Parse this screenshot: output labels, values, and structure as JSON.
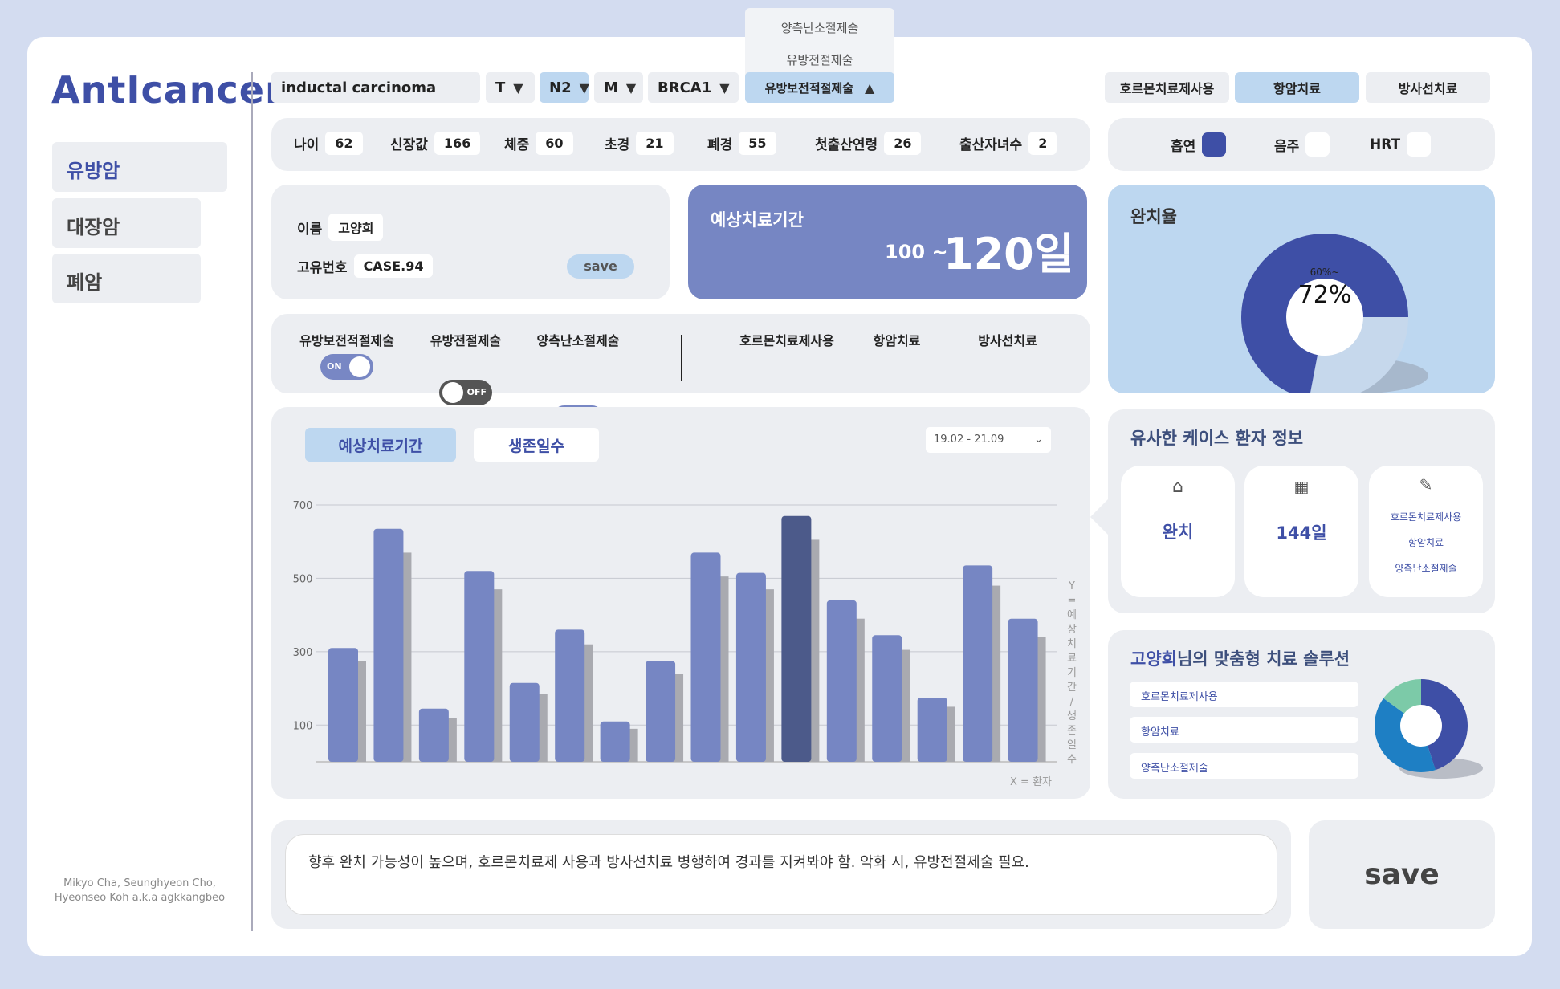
{
  "brand": {
    "logo": "AntIcancer"
  },
  "sidebar": {
    "items": [
      {
        "label": "유방암"
      },
      {
        "label": "대장암"
      },
      {
        "label": "폐암"
      }
    ],
    "credit_line1": "Mikyo Cha, Seunghyeon Cho,",
    "credit_line2": "Hyeonseo Koh a.k.a agkkangbeo"
  },
  "top": {
    "diagnosis": "inductal carcinoma",
    "t": "T",
    "n": "N2",
    "m": "M",
    "gene": "BRCA1",
    "surgery_options": [
      "양측난소절제술",
      "유방전절제술"
    ],
    "surgery_selected": "유방보전적절제술",
    "treatments": [
      "호르몬치료제사용",
      "항암치료",
      "방사선치료"
    ]
  },
  "stats": [
    {
      "label": "나이",
      "value": "62"
    },
    {
      "label": "신장값",
      "value": "166"
    },
    {
      "label": "체중",
      "value": "60"
    },
    {
      "label": "초경",
      "value": "21"
    },
    {
      "label": "폐경",
      "value": "55"
    },
    {
      "label": "첫출산연령",
      "value": "26"
    },
    {
      "label": "출산자녀수",
      "value": "2"
    }
  ],
  "habits": [
    {
      "label": "흡연",
      "checked": true
    },
    {
      "label": "음주",
      "checked": false
    },
    {
      "label": "HRT",
      "checked": false
    }
  ],
  "patient": {
    "name_label": "이름",
    "name": "고양희",
    "id_label": "고유번호",
    "id": "CASE.94",
    "save": "save"
  },
  "estimate": {
    "title": "예상치료기간",
    "range_from": "100 ~",
    "range_to": "120일"
  },
  "cure": {
    "title": "완치율",
    "sub": "60%~",
    "value": "72%",
    "fraction": 0.72
  },
  "toggles": [
    {
      "label": "유방보전적절제술",
      "state": "ON"
    },
    {
      "label": "유방전절제술",
      "state": "OFF"
    },
    {
      "label": "양측난소절제술",
      "state": "ON"
    },
    {
      "label": "호르몬치료제사용",
      "state": "OFF"
    },
    {
      "label": "항암치료",
      "state": "OFF"
    },
    {
      "label": "방사선치료",
      "state": "ON"
    }
  ],
  "chart_tabs": {
    "tab1": "예상치료기간",
    "tab2": "생존일수",
    "range": "19.02 - 21.09"
  },
  "chart_data": {
    "type": "bar",
    "yticks": [
      700,
      500,
      300,
      100
    ],
    "ylim": [
      0,
      770
    ],
    "ylabel": "Y = 예상치료기간 / 생존일수",
    "xlabel": "X = 환자",
    "highlight_index": 10,
    "series": [
      {
        "values": [
          310,
          635,
          145,
          520,
          215,
          360,
          110,
          275,
          570,
          515,
          670,
          440,
          345,
          175,
          535,
          390
        ]
      },
      {
        "values": [
          275,
          570,
          120,
          470,
          185,
          320,
          90,
          240,
          505,
          470,
          605,
          390,
          305,
          150,
          480,
          340
        ]
      }
    ]
  },
  "similar": {
    "title": "유사한 케이스 환자 정보",
    "outcome": "완치",
    "days": "144일",
    "treatments": [
      "호르몬치료제사용",
      "항암치료",
      "양측난소절제술"
    ]
  },
  "solution": {
    "name": "고양희",
    "suffix": "님의 맞춤형 치료 솔루션",
    "items": [
      "호르몬치료제사용",
      "항암치료",
      "양측난소절제술"
    ],
    "colors": [
      "#3e4fa6",
      "#1e7fc4",
      "#7ccaa8"
    ],
    "shares": [
      0.45,
      0.4,
      0.15
    ]
  },
  "note": {
    "text": "향후 완치 가능성이 높으며, 호르몬치료제 사용과 방사선치료 병행하여 경과를 지켜봐야 함. 악화 시, 유방전절제술 필요.",
    "save": "save"
  }
}
